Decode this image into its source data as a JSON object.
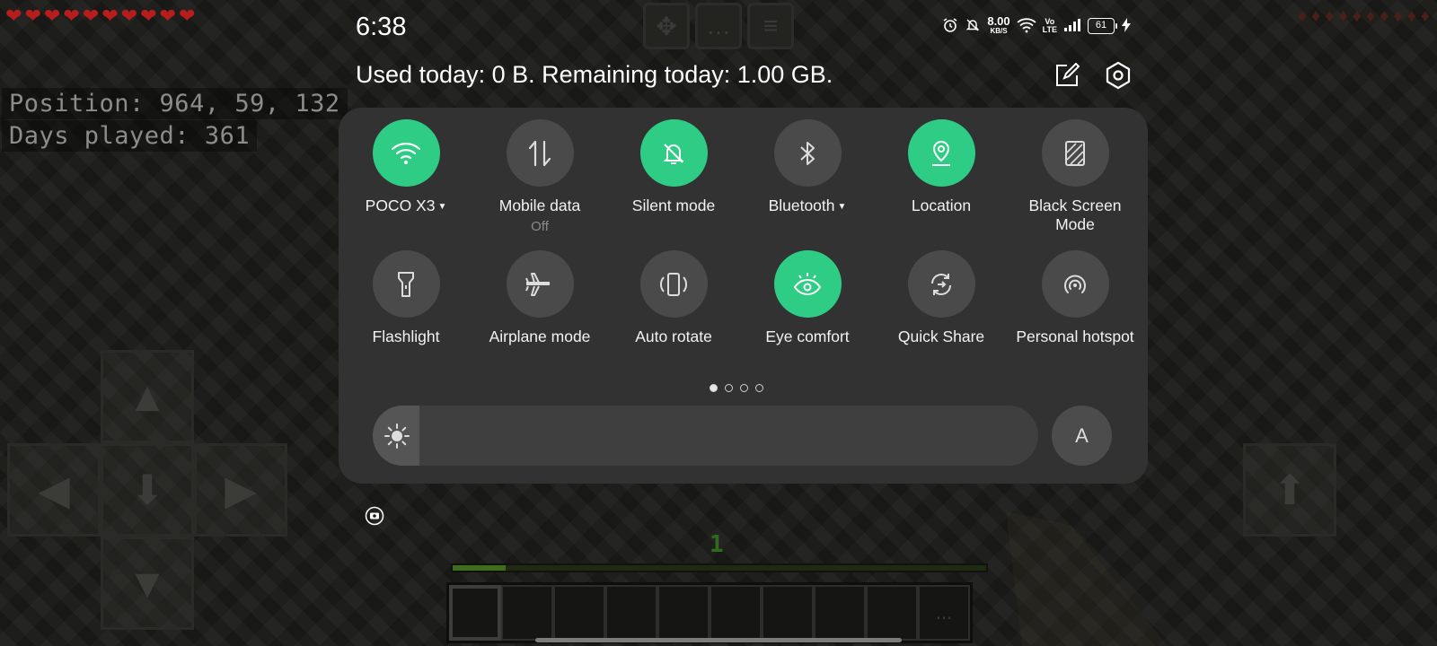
{
  "game": {
    "hearts": [
      "❤",
      "❤",
      "❤",
      "❤",
      "❤",
      "❤",
      "❤",
      "❤",
      "❤",
      "❤"
    ],
    "hunger": [
      "♦",
      "♦",
      "♦",
      "♦",
      "♦",
      "♦",
      "♦",
      "♦",
      "♦",
      "♦"
    ],
    "position_text": "Position: 964, 59, 132",
    "days_played_text": "Days played: 361",
    "level": "1",
    "xp_progress": 0.1,
    "top_buttons": [
      "emote-icon",
      "chat-icon",
      "menu-icon"
    ],
    "hotbar_more": "...",
    "dpad": {
      "up": "▲",
      "left": "◀",
      "center": "⬇",
      "right": "▶",
      "down": "▼"
    },
    "jump": "⬆"
  },
  "status_bar": {
    "time": "6:38",
    "net_speed_value": "8.00",
    "net_speed_unit": "KB/S",
    "volte_line1": "Vo",
    "volte_line2": "LTE",
    "battery": "61",
    "icons": [
      "alarm-icon",
      "mute-icon",
      "wifi-icon",
      "signal-icon",
      "charging-icon"
    ]
  },
  "header": {
    "data_usage": "Used today: 0 B. Remaining today: 1.00 GB.",
    "icons": [
      "edit-icon",
      "settings-icon"
    ]
  },
  "tiles": [
    {
      "label": "POCO X3",
      "sub": "",
      "has_caret": true,
      "on": true,
      "icon": "wifi-icon"
    },
    {
      "label": "Mobile data",
      "sub": "Off",
      "has_caret": false,
      "on": false,
      "icon": "mobile-data-icon"
    },
    {
      "label": "Silent mode",
      "sub": "",
      "has_caret": false,
      "on": true,
      "icon": "silent-icon"
    },
    {
      "label": "Bluetooth",
      "sub": "",
      "has_caret": true,
      "on": false,
      "icon": "bluetooth-icon"
    },
    {
      "label": "Location",
      "sub": "",
      "has_caret": false,
      "on": true,
      "icon": "location-icon"
    },
    {
      "label": "Black Screen Mode",
      "sub": "",
      "has_caret": false,
      "on": false,
      "icon": "black-screen-icon"
    },
    {
      "label": "Flashlight",
      "sub": "",
      "has_caret": false,
      "on": false,
      "icon": "flashlight-icon"
    },
    {
      "label": "Airplane mode",
      "sub": "",
      "has_caret": false,
      "on": false,
      "icon": "airplane-icon"
    },
    {
      "label": "Auto rotate",
      "sub": "",
      "has_caret": false,
      "on": false,
      "icon": "auto-rotate-icon"
    },
    {
      "label": "Eye comfort",
      "sub": "",
      "has_caret": false,
      "on": true,
      "icon": "eye-comfort-icon"
    },
    {
      "label": "Quick Share",
      "sub": "",
      "has_caret": false,
      "on": false,
      "icon": "quick-share-icon"
    },
    {
      "label": "Personal hotspot",
      "sub": "",
      "has_caret": false,
      "on": false,
      "icon": "hotspot-icon"
    }
  ],
  "pager": {
    "pages": 4,
    "active": 0
  },
  "brightness": {
    "level": 0.07,
    "icon": "brightness-icon",
    "auto_label": "A"
  },
  "colors": {
    "active_tile": "#2fcc85",
    "inactive_tile": "#4a4a4a",
    "panel": "#323232"
  }
}
